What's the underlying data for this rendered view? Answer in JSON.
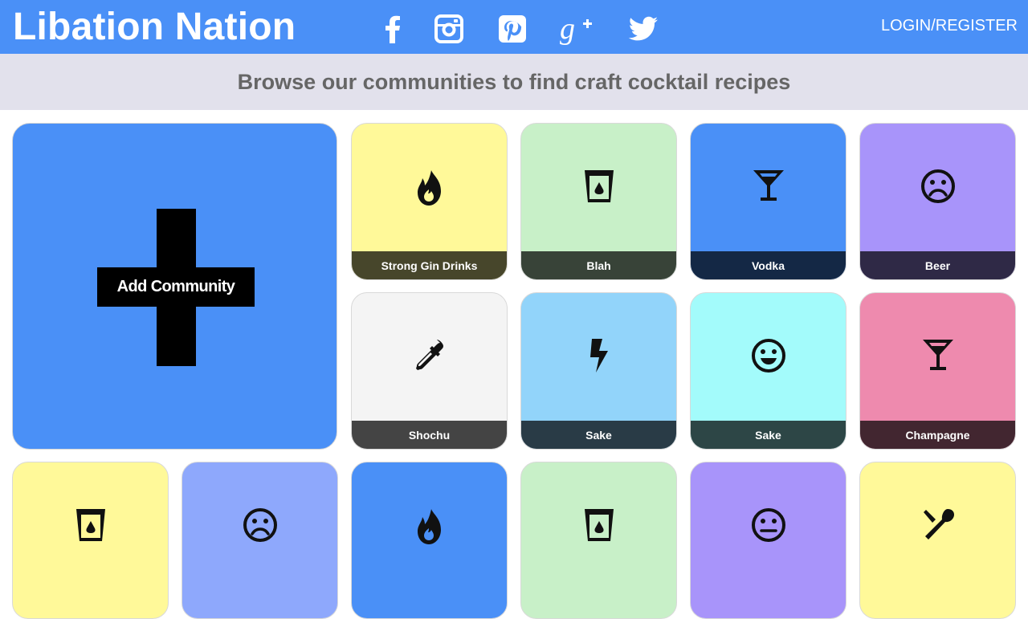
{
  "header": {
    "logo": "Libation Nation",
    "login": "LOGIN/REGISTER",
    "brand_color": "#4a90f7",
    "social": [
      "facebook-icon",
      "instagram-icon",
      "pinterest-icon",
      "google-plus-icon",
      "twitter-icon"
    ]
  },
  "subheader": {
    "text": "Browse our communities to find craft cocktail recipes"
  },
  "add_community": {
    "label": "Add Community"
  },
  "communities": [
    {
      "label": "Strong Gin Drinks",
      "icon": "flame-icon",
      "color": "#fff999"
    },
    {
      "label": "Blah",
      "icon": "glass-icon",
      "color": "#c8f0c8"
    },
    {
      "label": "Vodka",
      "icon": "martini-icon",
      "color": "#4a90f7"
    },
    {
      "label": "Beer",
      "icon": "sad-face-icon",
      "color": "#a894fa"
    },
    {
      "label": "Shochu",
      "icon": "eyedropper-icon",
      "color": "#f4f4f4"
    },
    {
      "label": "Sake",
      "icon": "bolt-icon",
      "color": "#92d4fa"
    },
    {
      "label": "Sake",
      "icon": "smiley-icon",
      "color": "#a3fbfb"
    },
    {
      "label": "Champagne",
      "icon": "martini-icon",
      "color": "#ee8aae"
    },
    {
      "label": "",
      "icon": "glass-icon",
      "color": "#fff999"
    },
    {
      "label": "",
      "icon": "sad-face-icon",
      "color": "#8ea8fc"
    },
    {
      "label": "",
      "icon": "flame-icon",
      "color": "#4a90f7"
    },
    {
      "label": "",
      "icon": "glass-icon",
      "color": "#c8f0c8"
    },
    {
      "label": "",
      "icon": "neutral-face-icon",
      "color": "#a894fa"
    },
    {
      "label": "",
      "icon": "utensils-icon",
      "color": "#fff999"
    }
  ]
}
